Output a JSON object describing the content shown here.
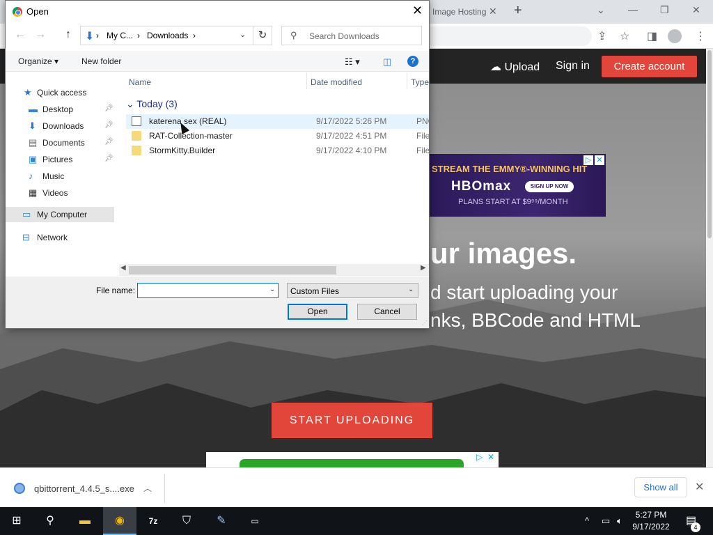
{
  "browser": {
    "tab_title": "Image Hosting",
    "tab_close": "✕",
    "new_tab": "+",
    "win_controls": {
      "collapse": "⌄",
      "minimize": "—",
      "restore": "❐",
      "close": "✕"
    },
    "toolbar_icons": [
      "share-icon",
      "star-icon",
      "sidebar-icon",
      "profile-icon",
      "menu-icon"
    ]
  },
  "website": {
    "nav": {
      "upload": "Upload",
      "signin": "Sign in",
      "create_account": "Create account"
    },
    "ad": {
      "line1": "STREAM THE EMMY®-WINNING HIT",
      "logo": "HBOmax",
      "signup": "SIGN UP NOW",
      "line2": "PLANS START AT $9⁹⁹/MONTH"
    },
    "hero_title": "ur images.",
    "hero_sub1": "d start uploading your",
    "hero_sub2": "nks, BBCode and HTML",
    "start_button": "START UPLOADING",
    "accent_color": "#e2453a"
  },
  "download_shelf": {
    "filename": "qbittorrent_4.4.5_s....exe",
    "show_all": "Show all"
  },
  "taskbar": {
    "time": "5:27 PM",
    "date": "9/17/2022",
    "notification_count": "4",
    "apps": [
      "start-icon",
      "search-icon",
      "file-explorer-icon",
      "chrome-icon",
      "7zip-icon",
      "security-icon",
      "paint-icon",
      "terminal-icon"
    ]
  },
  "dialog": {
    "title": "Open",
    "breadcrumb": {
      "segment1": "My C...",
      "segment2": "Downloads"
    },
    "search_placeholder": "Search Downloads",
    "commands": {
      "organize": "Organize ▾",
      "new_folder": "New folder"
    },
    "nav_pane": [
      {
        "label": "Quick access",
        "icon": "star-icon"
      },
      {
        "label": "Desktop",
        "icon": "desktop-icon",
        "pinned": true
      },
      {
        "label": "Downloads",
        "icon": "downloads-icon",
        "pinned": true
      },
      {
        "label": "Documents",
        "icon": "documents-icon",
        "pinned": true
      },
      {
        "label": "Pictures",
        "icon": "pictures-icon",
        "pinned": true
      },
      {
        "label": "Music",
        "icon": "music-icon"
      },
      {
        "label": "Videos",
        "icon": "videos-icon"
      },
      {
        "label": "My Computer",
        "icon": "computer-icon",
        "selected": true
      },
      {
        "label": "Network",
        "icon": "network-icon"
      }
    ],
    "columns": {
      "name": "Name",
      "date": "Date modified",
      "type": "Type"
    },
    "group": "Today (3)",
    "files": [
      {
        "name": "katerena sex (REAL)",
        "date": "9/17/2022 5:26 PM",
        "type": "PNG",
        "kind": "image"
      },
      {
        "name": "RAT-Collection-master",
        "date": "9/17/2022 4:51 PM",
        "type": "File fo",
        "kind": "folder"
      },
      {
        "name": "StormKitty.Builder",
        "date": "9/17/2022 4:10 PM",
        "type": "File fo",
        "kind": "folder"
      }
    ],
    "file_name_label": "File name:",
    "file_name_value": "",
    "filter_value": "Custom Files",
    "open_button": "Open",
    "cancel_button": "Cancel"
  }
}
